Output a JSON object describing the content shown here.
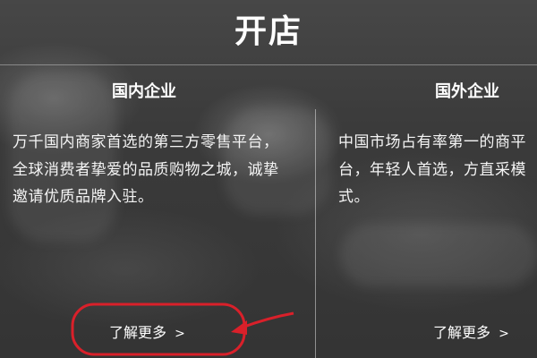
{
  "hero": {
    "title": "开店"
  },
  "cards": [
    {
      "title": "国内企业",
      "description": "万千国内商家首选的第三方零售平台，全球消费者挚爱的品质购物之城，诚挚邀请优质品牌入驻。",
      "link_label": "了解更多",
      "link_chevron": ">"
    },
    {
      "title": "国外企业",
      "description": "中国市场占有率第一的商平台，年轻人首选，方直采模式。",
      "link_label": "了解更多",
      "link_chevron": ">"
    }
  ],
  "annotation": {
    "color": "#d9202a"
  }
}
